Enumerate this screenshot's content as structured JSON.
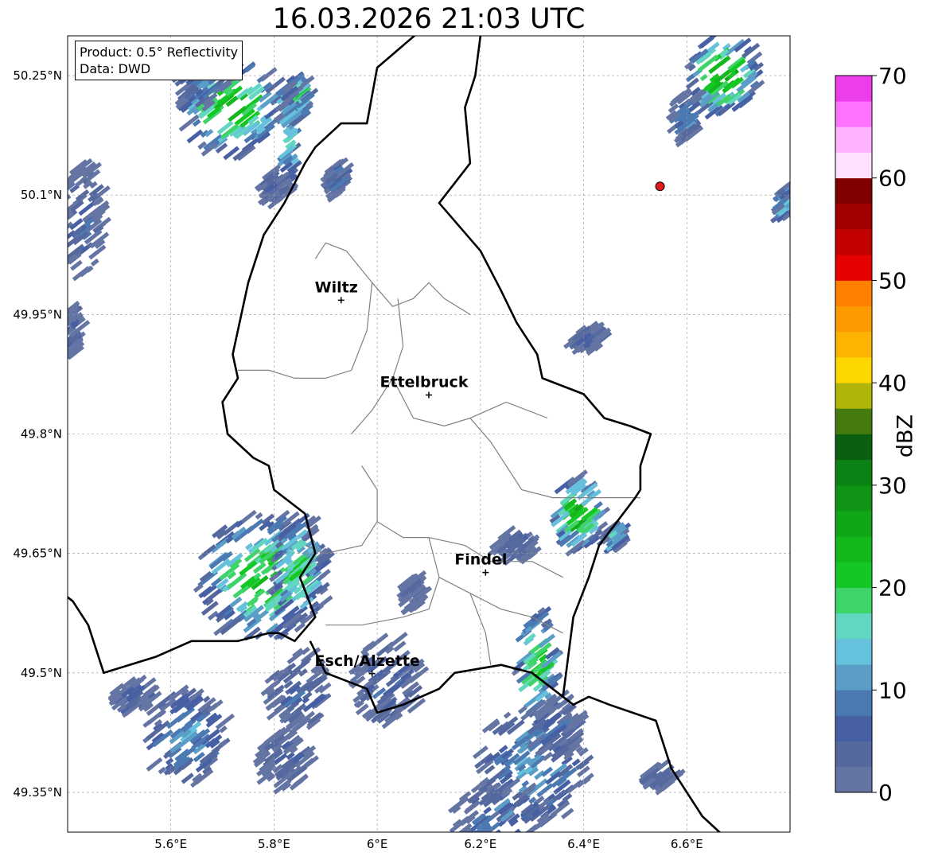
{
  "title": "16.03.2026 21:03 UTC",
  "info_box": {
    "product": "Product: 0.5° Reflectivity",
    "data": "Data: DWD"
  },
  "map_extent": {
    "lon": [
      5.4,
      6.8
    ],
    "lat": [
      49.3,
      50.3
    ]
  },
  "lat_ticks": [
    {
      "value": 50.25,
      "label": "50.25°N"
    },
    {
      "value": 50.1,
      "label": "50.1°N"
    },
    {
      "value": 49.95,
      "label": "49.95°N"
    },
    {
      "value": 49.8,
      "label": "49.8°N"
    },
    {
      "value": 49.65,
      "label": "49.65°N"
    },
    {
      "value": 49.5,
      "label": "49.5°N"
    },
    {
      "value": 49.35,
      "label": "49.35°N"
    }
  ],
  "lon_ticks": [
    {
      "value": 5.6,
      "label": "5.6°E"
    },
    {
      "value": 5.8,
      "label": "5.8°E"
    },
    {
      "value": 6.0,
      "label": "6°E"
    },
    {
      "value": 6.2,
      "label": "6.2°E"
    },
    {
      "value": 6.4,
      "label": "6.4°E"
    },
    {
      "value": 6.6,
      "label": "6.6°E"
    }
  ],
  "cities": [
    {
      "name": "Wiltz",
      "lon": 5.93,
      "lat": 49.968
    },
    {
      "name": "Ettelbruck",
      "lon": 6.1,
      "lat": 49.849
    },
    {
      "name": "Findel",
      "lon": 6.21,
      "lat": 49.626
    },
    {
      "name": "Esch/Alzette",
      "lon": 5.99,
      "lat": 49.499
    }
  ],
  "radar_site": {
    "lon": 6.548,
    "lat": 50.111,
    "color": "#e31a1c"
  },
  "colorbar": {
    "label": "dBZ",
    "min": 0,
    "max": 70,
    "step": 2.5,
    "tick_labels": [
      "0",
      "10",
      "20",
      "30",
      "40",
      "50",
      "60",
      "70"
    ],
    "colors": [
      "#6475a4",
      "#56699f",
      "#4760a4",
      "#4b79b2",
      "#5a9ec8",
      "#66c1dc",
      "#61d6c0",
      "#3ed46a",
      "#14c824",
      "#12b81c",
      "#11a618",
      "#0f9416",
      "#0d8214",
      "#0a5f10",
      "#447a0e",
      "#afb50a",
      "#ffd700",
      "#fcb400",
      "#fd9a00",
      "#ff7f00",
      "#e60000",
      "#c20000",
      "#a00000",
      "#800000",
      "#ffe0ff",
      "#ffb3ff",
      "#ff73ff",
      "#ec3cec"
    ]
  },
  "echo_cells": [
    {
      "lon": 5.72,
      "lat": 50.21,
      "a": 0.1,
      "b": 0.06,
      "peak": 26
    },
    {
      "lon": 5.84,
      "lat": 50.22,
      "a": 0.03,
      "b": 0.03,
      "peak": 24
    },
    {
      "lon": 5.83,
      "lat": 50.17,
      "a": 0.015,
      "b": 0.07,
      "peak": 18
    },
    {
      "lon": 5.66,
      "lat": 50.25,
      "a": 0.05,
      "b": 0.04,
      "peak": 14
    },
    {
      "lon": 5.43,
      "lat": 50.07,
      "a": 0.04,
      "b": 0.07,
      "peak": 9
    },
    {
      "lon": 5.41,
      "lat": 49.93,
      "a": 0.015,
      "b": 0.03,
      "peak": 9
    },
    {
      "lon": 5.8,
      "lat": 50.11,
      "a": 0.02,
      "b": 0.02,
      "peak": 9
    },
    {
      "lon": 5.92,
      "lat": 50.12,
      "a": 0.02,
      "b": 0.02,
      "peak": 10
    },
    {
      "lon": 6.67,
      "lat": 50.25,
      "a": 0.07,
      "b": 0.05,
      "peak": 28
    },
    {
      "lon": 6.6,
      "lat": 50.2,
      "a": 0.03,
      "b": 0.03,
      "peak": 14
    },
    {
      "lon": 6.79,
      "lat": 50.09,
      "a": 0.015,
      "b": 0.02,
      "peak": 20
    },
    {
      "lon": 6.39,
      "lat": 49.7,
      "a": 0.05,
      "b": 0.045,
      "peak": 28
    },
    {
      "lon": 6.46,
      "lat": 49.67,
      "a": 0.02,
      "b": 0.015,
      "peak": 18
    },
    {
      "lon": 6.27,
      "lat": 49.66,
      "a": 0.04,
      "b": 0.02,
      "peak": 8
    },
    {
      "lon": 6.41,
      "lat": 49.92,
      "a": 0.03,
      "b": 0.015,
      "peak": 8
    },
    {
      "lon": 5.78,
      "lat": 49.62,
      "a": 0.13,
      "b": 0.08,
      "peak": 24
    },
    {
      "lon": 5.85,
      "lat": 49.63,
      "a": 0.05,
      "b": 0.07,
      "peak": 22
    },
    {
      "lon": 6.02,
      "lat": 49.49,
      "a": 0.07,
      "b": 0.055,
      "peak": 9
    },
    {
      "lon": 5.85,
      "lat": 49.48,
      "a": 0.06,
      "b": 0.05,
      "peak": 9
    },
    {
      "lon": 5.63,
      "lat": 49.42,
      "a": 0.08,
      "b": 0.06,
      "peak": 14
    },
    {
      "lon": 5.53,
      "lat": 49.47,
      "a": 0.04,
      "b": 0.02,
      "peak": 8
    },
    {
      "lon": 5.82,
      "lat": 49.39,
      "a": 0.05,
      "b": 0.035,
      "peak": 9
    },
    {
      "lon": 6.31,
      "lat": 49.51,
      "a": 0.04,
      "b": 0.07,
      "peak": 24
    },
    {
      "lon": 6.3,
      "lat": 49.38,
      "a": 0.11,
      "b": 0.08,
      "peak": 14
    },
    {
      "lon": 6.24,
      "lat": 49.32,
      "a": 0.09,
      "b": 0.04,
      "peak": 12
    },
    {
      "lon": 6.35,
      "lat": 49.43,
      "a": 0.05,
      "b": 0.04,
      "peak": 10
    },
    {
      "lon": 6.55,
      "lat": 49.37,
      "a": 0.03,
      "b": 0.015,
      "peak": 8
    },
    {
      "lon": 6.07,
      "lat": 49.6,
      "a": 0.02,
      "b": 0.02,
      "peak": 7
    }
  ],
  "borders": {
    "country": [
      [
        [
          6.0,
          50.51
        ],
        [
          6.05,
          50.35
        ],
        [
          6.09,
          50.31
        ],
        [
          6.0,
          50.26
        ],
        [
          5.98,
          50.19
        ],
        [
          5.93,
          50.19
        ],
        [
          5.88,
          50.16
        ],
        [
          5.86,
          50.14
        ],
        [
          5.82,
          50.09
        ],
        [
          5.78,
          50.05
        ],
        [
          5.75,
          49.99
        ],
        [
          5.74,
          49.96
        ],
        [
          5.72,
          49.9
        ],
        [
          5.73,
          49.87
        ],
        [
          5.7,
          49.84
        ],
        [
          5.71,
          49.8
        ],
        [
          5.76,
          49.77
        ],
        [
          5.79,
          49.76
        ],
        [
          5.8,
          49.73
        ],
        [
          5.86,
          49.7
        ],
        [
          5.88,
          49.65
        ],
        [
          5.85,
          49.62
        ],
        [
          5.88,
          49.57
        ],
        [
          5.84,
          49.54
        ],
        [
          5.81,
          49.55
        ],
        [
          5.79,
          49.55
        ],
        [
          5.73,
          49.54
        ],
        [
          5.64,
          49.54
        ],
        [
          5.57,
          49.52
        ],
        [
          5.47,
          49.5
        ],
        [
          5.44,
          49.56
        ],
        [
          5.41,
          49.59
        ],
        [
          5.37,
          49.61
        ]
      ],
      [
        [
          6.13,
          50.51
        ],
        [
          6.28,
          50.35
        ],
        [
          6.2,
          50.3
        ],
        [
          6.19,
          50.25
        ],
        [
          6.17,
          50.21
        ],
        [
          6.18,
          50.14
        ],
        [
          6.12,
          50.09
        ],
        [
          6.16,
          50.06
        ],
        [
          6.2,
          50.03
        ],
        [
          6.24,
          49.98
        ],
        [
          6.27,
          49.94
        ],
        [
          6.31,
          49.9
        ],
        [
          6.32,
          49.87
        ],
        [
          6.36,
          49.86
        ],
        [
          6.4,
          49.85
        ],
        [
          6.44,
          49.82
        ],
        [
          6.49,
          49.81
        ],
        [
          6.53,
          49.8
        ],
        [
          6.51,
          49.76
        ],
        [
          6.51,
          49.73
        ],
        [
          6.5,
          49.72
        ],
        [
          6.43,
          49.66
        ],
        [
          6.41,
          49.62
        ],
        [
          6.38,
          49.57
        ],
        [
          6.37,
          49.52
        ],
        [
          6.36,
          49.47
        ],
        [
          6.38,
          49.46
        ],
        [
          6.41,
          49.47
        ],
        [
          6.45,
          49.46
        ],
        [
          6.54,
          49.44
        ],
        [
          6.57,
          49.38
        ],
        [
          6.59,
          49.36
        ],
        [
          6.63,
          49.32
        ],
        [
          6.68,
          49.29
        ]
      ],
      [
        [
          5.87,
          49.54
        ],
        [
          5.9,
          49.5
        ],
        [
          5.98,
          49.48
        ],
        [
          6.0,
          49.45
        ],
        [
          6.05,
          49.46
        ],
        [
          6.12,
          49.48
        ],
        [
          6.15,
          49.5
        ],
        [
          6.24,
          49.51
        ],
        [
          6.3,
          49.5
        ],
        [
          6.36,
          49.47
        ]
      ]
    ],
    "district": [
      [
        [
          5.88,
          50.02
        ],
        [
          5.9,
          50.04
        ],
        [
          5.94,
          50.03
        ],
        [
          5.99,
          49.99
        ],
        [
          5.98,
          49.93
        ],
        [
          5.95,
          49.88
        ],
        [
          5.9,
          49.87
        ],
        [
          5.84,
          49.87
        ],
        [
          5.79,
          49.88
        ],
        [
          5.73,
          49.88
        ]
      ],
      [
        [
          5.99,
          49.99
        ],
        [
          6.03,
          49.96
        ],
        [
          6.07,
          49.97
        ],
        [
          6.1,
          49.99
        ],
        [
          6.13,
          49.97
        ],
        [
          6.18,
          49.95
        ]
      ],
      [
        [
          6.04,
          49.97
        ],
        [
          6.05,
          49.91
        ],
        [
          6.03,
          49.87
        ],
        [
          5.99,
          49.83
        ],
        [
          5.95,
          49.8
        ]
      ],
      [
        [
          6.03,
          49.87
        ],
        [
          6.07,
          49.82
        ],
        [
          6.13,
          49.81
        ],
        [
          6.18,
          49.82
        ],
        [
          6.25,
          49.84
        ],
        [
          6.33,
          49.82
        ]
      ],
      [
        [
          6.18,
          49.82
        ],
        [
          6.22,
          49.79
        ],
        [
          6.25,
          49.76
        ],
        [
          6.28,
          49.73
        ],
        [
          6.34,
          49.72
        ],
        [
          6.4,
          49.72
        ],
        [
          6.51,
          49.72
        ]
      ],
      [
        [
          5.97,
          49.76
        ],
        [
          6.0,
          49.73
        ],
        [
          6.0,
          49.69
        ],
        [
          5.97,
          49.66
        ],
        [
          5.9,
          49.65
        ],
        [
          5.86,
          49.66
        ]
      ],
      [
        [
          6.0,
          49.69
        ],
        [
          6.05,
          49.67
        ],
        [
          6.1,
          49.67
        ],
        [
          6.17,
          49.66
        ],
        [
          6.22,
          49.64
        ],
        [
          6.3,
          49.64
        ],
        [
          6.36,
          49.62
        ]
      ],
      [
        [
          6.1,
          49.67
        ],
        [
          6.12,
          49.62
        ],
        [
          6.1,
          49.58
        ],
        [
          6.05,
          49.57
        ],
        [
          5.97,
          49.56
        ],
        [
          5.9,
          49.56
        ]
      ],
      [
        [
          6.12,
          49.62
        ],
        [
          6.18,
          49.6
        ],
        [
          6.24,
          49.58
        ],
        [
          6.3,
          49.57
        ],
        [
          6.36,
          49.55
        ]
      ],
      [
        [
          6.18,
          49.6
        ],
        [
          6.21,
          49.55
        ],
        [
          6.22,
          49.51
        ]
      ]
    ]
  }
}
